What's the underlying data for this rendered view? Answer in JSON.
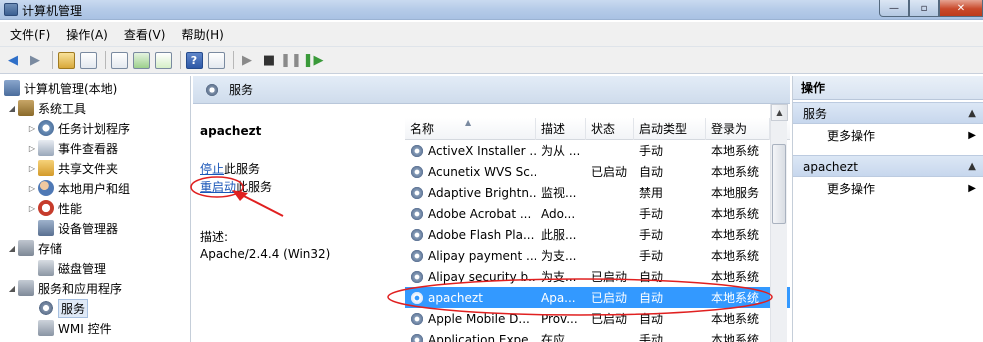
{
  "window": {
    "title": "计算机管理"
  },
  "menu": [
    "文件(F)",
    "操作(A)",
    "查看(V)",
    "帮助(H)"
  ],
  "tree": [
    {
      "label": "计算机管理(本地)",
      "icon": "computer-icon"
    },
    {
      "label": "系统工具",
      "icon": "tools-icon"
    },
    {
      "label": "任务计划程序",
      "icon": "task-scheduler-icon"
    },
    {
      "label": "事件查看器",
      "icon": "event-viewer-icon"
    },
    {
      "label": "共享文件夹",
      "icon": "shared-folder-icon"
    },
    {
      "label": "本地用户和组",
      "icon": "users-icon"
    },
    {
      "label": "性能",
      "icon": "performance-icon"
    },
    {
      "label": "设备管理器",
      "icon": "device-manager-icon"
    },
    {
      "label": "存储",
      "icon": "storage-icon"
    },
    {
      "label": "磁盘管理",
      "icon": "disk-icon"
    },
    {
      "label": "服务和应用程序",
      "icon": "services-apps-icon"
    },
    {
      "label": "服务",
      "icon": "gear-icon"
    },
    {
      "label": "WMI 控件",
      "icon": "wmi-icon"
    }
  ],
  "center": {
    "header": "服务",
    "detail": {
      "name": "apachezt",
      "stop_link": "停止",
      "stop_suffix": "此服务",
      "restart_link": "重启动",
      "restart_suffix": "此服务",
      "desc_label": "描述:",
      "desc_value": "Apache/2.4.4 (Win32)"
    },
    "columns": [
      "名称",
      "描述",
      "状态",
      "启动类型",
      "登录为"
    ],
    "rows": [
      {
        "name": "ActiveX Installer ...",
        "desc": "为从 ...",
        "status": "",
        "startup": "手动",
        "logon": "本地系统"
      },
      {
        "name": "Acunetix WVS Sc...",
        "desc": "",
        "status": "已启动",
        "startup": "自动",
        "logon": "本地系统"
      },
      {
        "name": "Adaptive Brightn...",
        "desc": "监视...",
        "status": "",
        "startup": "禁用",
        "logon": "本地服务"
      },
      {
        "name": "Adobe Acrobat ...",
        "desc": "Ado...",
        "status": "",
        "startup": "手动",
        "logon": "本地系统"
      },
      {
        "name": "Adobe Flash Pla...",
        "desc": "此服...",
        "status": "",
        "startup": "手动",
        "logon": "本地系统"
      },
      {
        "name": "Alipay payment ...",
        "desc": "为支...",
        "status": "",
        "startup": "手动",
        "logon": "本地系统"
      },
      {
        "name": "Alipay security b...",
        "desc": "为支...",
        "status": "已启动",
        "startup": "自动",
        "logon": "本地系统"
      },
      {
        "name": "apachezt",
        "desc": "Apa...",
        "status": "已启动",
        "startup": "自动",
        "logon": "本地系统",
        "selected": true
      },
      {
        "name": "Apple Mobile D...",
        "desc": "Prov...",
        "status": "已启动",
        "startup": "自动",
        "logon": "本地系统"
      },
      {
        "name": "Application Expe...",
        "desc": "在应...",
        "status": "",
        "startup": "手动",
        "logon": "本地系统"
      }
    ]
  },
  "actions": {
    "title": "操作",
    "groups": [
      {
        "label": "服务",
        "item": "更多操作"
      },
      {
        "label": "apachezt",
        "item": "更多操作"
      }
    ]
  },
  "colors": {
    "selection": "#3399ff",
    "link": "#1a56b8",
    "annotation": "#e02020"
  }
}
